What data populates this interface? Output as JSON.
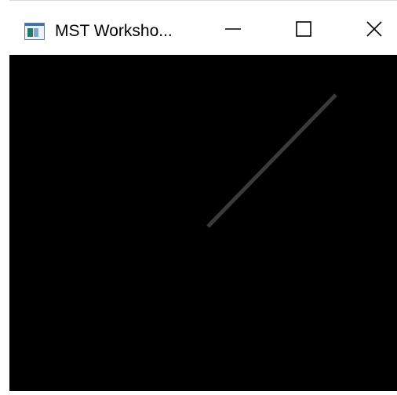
{
  "window": {
    "title": "MST Worksho...",
    "icon": "app-window-icon",
    "controls": {
      "minimize": "minimize-icon",
      "maximize": "maximize-icon",
      "close": "close-icon"
    }
  },
  "canvas": {
    "background": "#000000",
    "line_color": "#3a3a3a"
  }
}
